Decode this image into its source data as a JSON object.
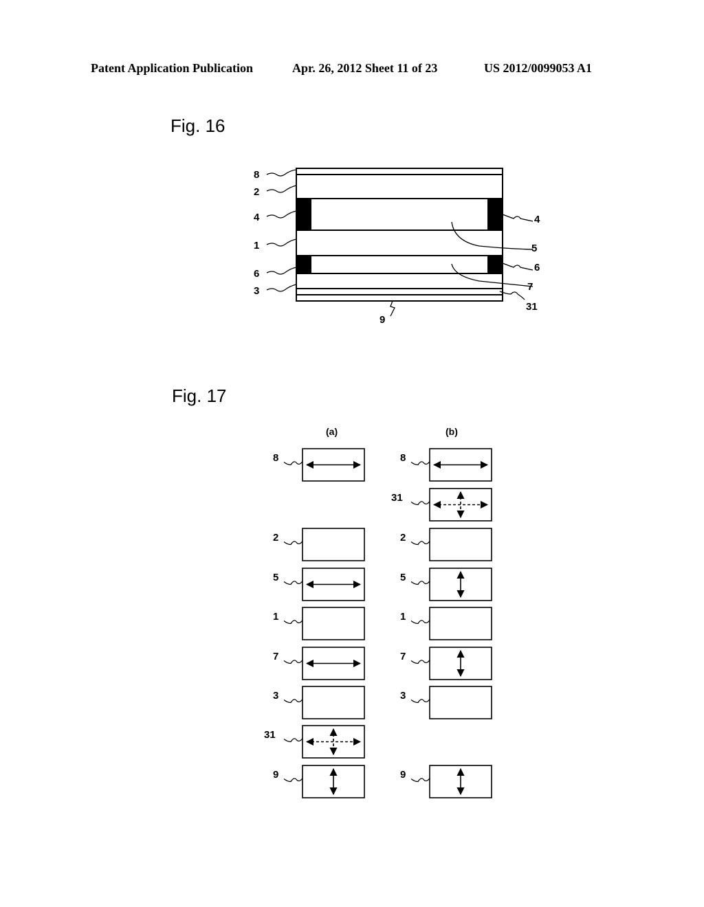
{
  "header": {
    "left": "Patent Application Publication",
    "center": "Apr. 26, 2012  Sheet 11 of 23",
    "right": "US 2012/0099053 A1"
  },
  "fig16": {
    "title": "Fig. 16",
    "left_labels": [
      "8",
      "2",
      "4",
      "1",
      "6",
      "3"
    ],
    "right_labels": [
      "4",
      "5",
      "6",
      "7",
      "31"
    ],
    "bottom_label": "9"
  },
  "fig17": {
    "title": "Fig. 17",
    "column_a": {
      "heading": "(a)",
      "layers": [
        {
          "label": "8",
          "arrow": "horizontal"
        },
        {
          "label": "2",
          "arrow": "none"
        },
        {
          "label": "5",
          "arrow": "horizontal"
        },
        {
          "label": "1",
          "arrow": "none"
        },
        {
          "label": "7",
          "arrow": "horizontal"
        },
        {
          "label": "3",
          "arrow": "none"
        },
        {
          "label": "31",
          "arrow": "cross-dashed"
        },
        {
          "label": "9",
          "arrow": "vertical"
        }
      ]
    },
    "column_b": {
      "heading": "(b)",
      "layers": [
        {
          "label": "8",
          "arrow": "horizontal"
        },
        {
          "label": "31",
          "arrow": "cross-dashed"
        },
        {
          "label": "2",
          "arrow": "none"
        },
        {
          "label": "5",
          "arrow": "vertical"
        },
        {
          "label": "1",
          "arrow": "none"
        },
        {
          "label": "7",
          "arrow": "vertical"
        },
        {
          "label": "3",
          "arrow": "none"
        },
        {
          "label": "9",
          "arrow": "vertical"
        }
      ]
    }
  }
}
